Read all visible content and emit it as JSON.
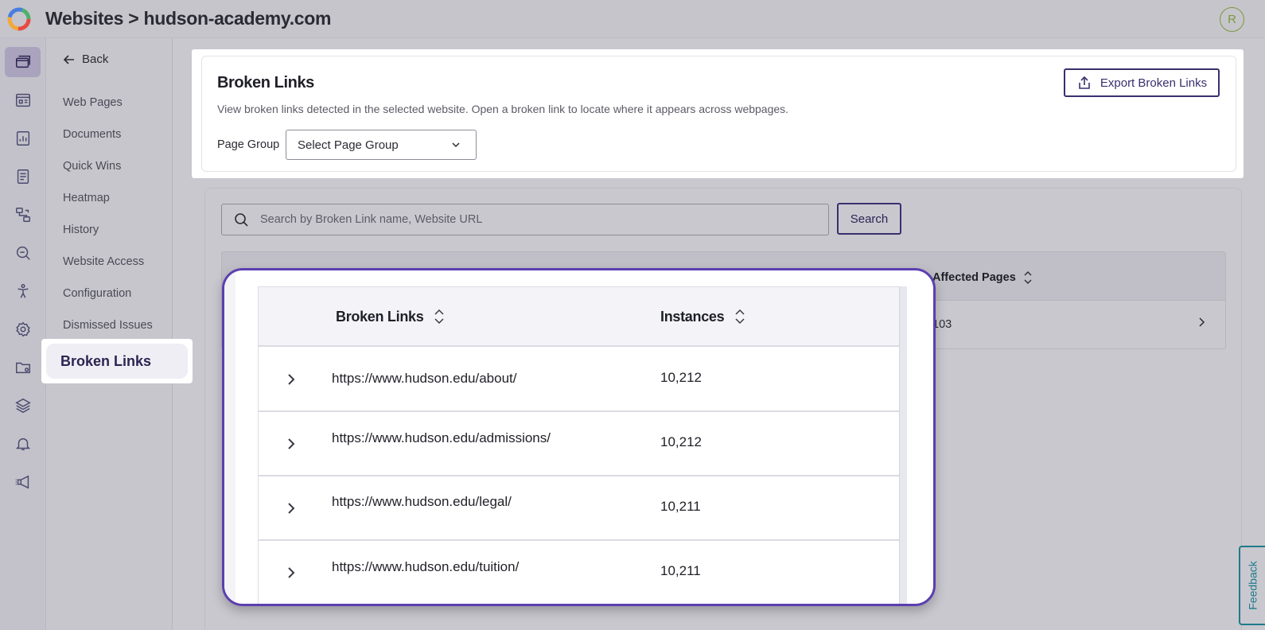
{
  "app": {
    "title": "Websites > hudson-academy.com",
    "avatar_initial": "R"
  },
  "rail": {
    "icons": [
      "websites-icon",
      "dashboard-icon",
      "reports-icon",
      "document-icon",
      "workflow-icon",
      "scan-search-icon",
      "accessibility-icon",
      "settings-icon",
      "folder-settings-icon",
      "layers-icon",
      "notifications-icon",
      "announcements-icon"
    ]
  },
  "subnav": {
    "back_label": "Back",
    "items": [
      "Web Pages",
      "Documents",
      "Quick Wins",
      "Heatmap",
      "History",
      "Website Access",
      "Configuration",
      "Dismissed Issues"
    ],
    "active_label": "Broken Links"
  },
  "header": {
    "title": "Broken Links",
    "description": "View broken links detected in the selected website. Open a broken link to locate where it appears across webpages.",
    "page_group_label": "Page Group",
    "page_group_placeholder": "Select Page Group",
    "export_label": "Export Broken Links"
  },
  "search": {
    "placeholder": "Search by Broken Link name, Website URL",
    "button_label": "Search"
  },
  "table": {
    "columns": {
      "broken_links": "Broken Links",
      "instances": "Instances",
      "affected_pages": "Affected Pages"
    },
    "first_row_affected": "103",
    "rows": [
      {
        "url": "https://www.hudson.edu/about/",
        "instances": "10,212"
      },
      {
        "url": "https://www.hudson.edu/admissions/",
        "instances": "10,212"
      },
      {
        "url": "https://www.hudson.edu/legal/",
        "instances": "10,211"
      },
      {
        "url": "https://www.hudson.edu/tuition/",
        "instances": "10,211"
      }
    ]
  },
  "feedback_label": "Feedback",
  "colors": {
    "accent": "#3b2f6e",
    "callout_border": "#5b3fb0",
    "feedback": "#1e7b8a"
  }
}
